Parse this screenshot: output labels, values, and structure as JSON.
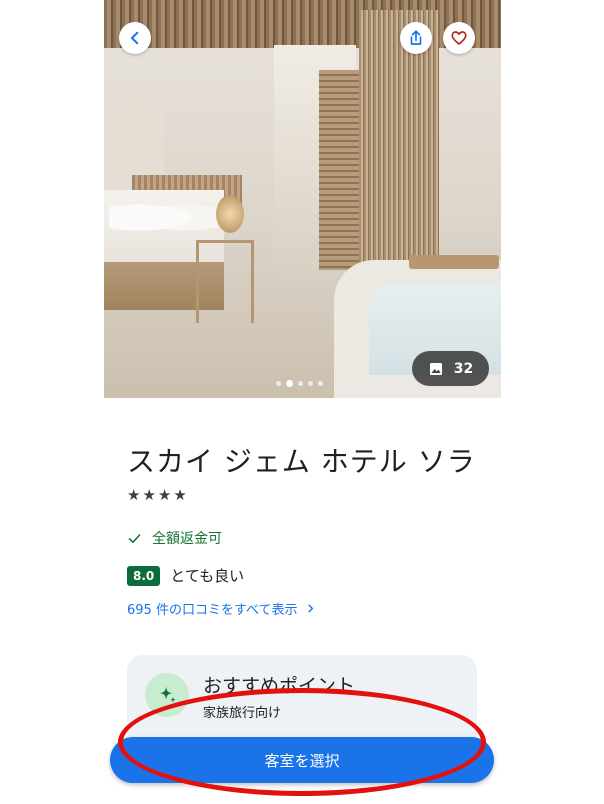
{
  "hero": {
    "photo_count": "32",
    "pager_total": 5,
    "pager_active_index": 1
  },
  "hotel": {
    "name": "スカイ ジェム ホテル ソラ",
    "stars": 4,
    "refund_label": "全額返金可",
    "rating_score": "8.0",
    "rating_label": "とても良い",
    "reviews_link": "695 件の口コミをすべて表示"
  },
  "highlight": {
    "title": "おすすめポイント",
    "subtitle": "家族旅行向け"
  },
  "cta": {
    "select_room_label": "客室を選択"
  },
  "colors": {
    "primary": "#1a73e8",
    "rating_badge": "#0d6b3d",
    "refund_green": "#137333",
    "annotation_red": "#e3100e"
  },
  "icons": {
    "back": "chevron-left-icon",
    "share": "share-icon",
    "favorite": "heart-icon",
    "photos": "image-gallery-icon",
    "refund": "check-icon",
    "reviews": "chevron-right-icon",
    "highlight": "sparkle-icon"
  }
}
